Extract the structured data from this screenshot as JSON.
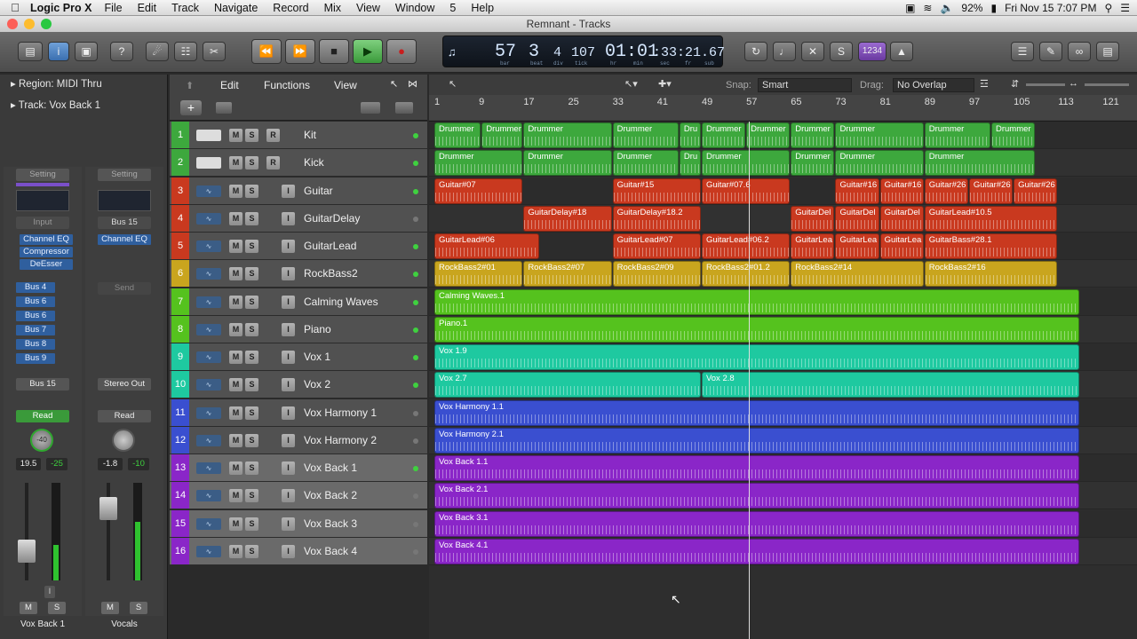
{
  "menubar": {
    "app_name": "Logic Pro X",
    "items": [
      "File",
      "Edit",
      "Track",
      "Navigate",
      "Record",
      "Mix",
      "View",
      "Window",
      "5",
      "Help"
    ],
    "battery": "92%",
    "datetime": "Fri Nov 15  7:07 PM"
  },
  "window": {
    "title": "Remnant - Tracks"
  },
  "lcd": {
    "bar": "57",
    "beat": "3",
    "div": "4",
    "tick": "107",
    "time_hm": "01:01",
    "time_rest": ":33:21.67",
    "labels": [
      "bar",
      "beat",
      "div",
      "tick",
      "hr",
      "min",
      "sec",
      "fr",
      "sub"
    ]
  },
  "lcd_btn": "1234",
  "inspector": {
    "region_label": "Region: MIDI Thru",
    "track_label": "Track:  Vox Back 1",
    "left_strip": {
      "setting": "Setting",
      "input": "Input",
      "plugins": [
        "Channel EQ",
        "Compressor",
        "DeEsser"
      ],
      "sends": [
        "Bus 4",
        "Bus 6",
        "Bus 6",
        "Bus 7",
        "Bus 8",
        "Bus 9"
      ],
      "output": "Bus 15",
      "mode": "Read",
      "knob": "-40",
      "vol": "19.5",
      "peak": "-25",
      "m": "M",
      "s": "S",
      "i": "I",
      "name": "Vox Back 1"
    },
    "right_strip": {
      "setting": "Setting",
      "input": "Bus 15",
      "plugins": [
        "Channel EQ"
      ],
      "send": "Send",
      "output": "Stereo Out",
      "mode": "Read",
      "vol": "-1.8",
      "peak": "-10",
      "m": "M",
      "s": "S",
      "name": "Vocals"
    }
  },
  "trackheader": {
    "edit": "Edit",
    "functions": "Functions",
    "view": "View",
    "add": "+"
  },
  "arrange_toolbar": {
    "snap_label": "Snap:",
    "snap_value": "Smart",
    "drag_label": "Drag:",
    "drag_value": "No Overlap"
  },
  "ruler": [
    "1",
    "9",
    "17",
    "25",
    "33",
    "41",
    "49",
    "57",
    "65",
    "73",
    "81",
    "89",
    "97",
    "105",
    "113",
    "121"
  ],
  "tracks": [
    {
      "num": "1",
      "name": "Kit",
      "color": "#3da83d",
      "kind": "drum",
      "r": true,
      "i": false,
      "led": "#3fd13f"
    },
    {
      "num": "2",
      "name": "Kick",
      "color": "#3da83d",
      "kind": "drum",
      "r": true,
      "i": false,
      "led": "#3fd13f"
    },
    {
      "num": "3",
      "name": "Guitar",
      "color": "#c9391f",
      "kind": "audio",
      "r": false,
      "i": true,
      "led": "#3fd13f"
    },
    {
      "num": "4",
      "name": "GuitarDelay",
      "color": "#c9391f",
      "kind": "audio",
      "r": false,
      "i": true,
      "led": "#777"
    },
    {
      "num": "5",
      "name": "GuitarLead",
      "color": "#c9391f",
      "kind": "audio",
      "r": false,
      "i": true,
      "led": "#3fd13f"
    },
    {
      "num": "6",
      "name": "RockBass2",
      "color": "#c9a51e",
      "kind": "audio",
      "r": false,
      "i": true,
      "led": "#3fd13f"
    },
    {
      "num": "7",
      "name": "Calming Waves",
      "color": "#55c21e",
      "kind": "audio",
      "r": false,
      "i": true,
      "led": "#3fd13f"
    },
    {
      "num": "8",
      "name": "Piano",
      "color": "#55c21e",
      "kind": "audio",
      "r": false,
      "i": true,
      "led": "#3fd13f"
    },
    {
      "num": "9",
      "name": "Vox 1",
      "color": "#1ec9a0",
      "kind": "audio",
      "r": false,
      "i": true,
      "led": "#3fd13f"
    },
    {
      "num": "10",
      "name": "Vox 2",
      "color": "#1ec9a0",
      "kind": "audio",
      "r": false,
      "i": true,
      "led": "#3fd13f"
    },
    {
      "num": "11",
      "name": "Vox Harmony 1",
      "color": "#3a4fd0",
      "kind": "audio",
      "r": false,
      "i": true,
      "led": "#777"
    },
    {
      "num": "12",
      "name": "Vox Harmony 2",
      "color": "#3a4fd0",
      "kind": "audio",
      "r": false,
      "i": true,
      "led": "#777"
    },
    {
      "num": "13",
      "name": "Vox Back 1",
      "color": "#8a26c8",
      "kind": "audio",
      "r": false,
      "i": true,
      "led": "#3fd13f",
      "sel": true
    },
    {
      "num": "14",
      "name": "Vox Back 2",
      "color": "#8a26c8",
      "kind": "audio",
      "r": false,
      "i": true,
      "led": "#777",
      "sel": true
    },
    {
      "num": "15",
      "name": "Vox Back 3",
      "color": "#8a26c8",
      "kind": "audio",
      "r": false,
      "i": true,
      "led": "#777",
      "sel": true
    },
    {
      "num": "16",
      "name": "Vox Back 4",
      "color": "#8a26c8",
      "kind": "audio",
      "r": false,
      "i": true,
      "led": "#777",
      "sel": true
    }
  ],
  "regions": [
    {
      "row": 0,
      "label": "Drummer",
      "start": 1,
      "end": 9.5
    },
    {
      "row": 0,
      "label": "Drummer",
      "start": 9.5,
      "end": 17
    },
    {
      "row": 0,
      "label": "Drummer",
      "start": 17,
      "end": 33
    },
    {
      "row": 0,
      "label": "Drummer",
      "start": 33,
      "end": 45
    },
    {
      "row": 0,
      "label": "Dru",
      "start": 45,
      "end": 49
    },
    {
      "row": 0,
      "label": "Drummer",
      "start": 49,
      "end": 57
    },
    {
      "row": 0,
      "label": "Drummer",
      "start": 57,
      "end": 65
    },
    {
      "row": 0,
      "label": "Drummer",
      "start": 65,
      "end": 73
    },
    {
      "row": 0,
      "label": "Drummer",
      "start": 73,
      "end": 89
    },
    {
      "row": 0,
      "label": "Drummer",
      "start": 89,
      "end": 101
    },
    {
      "row": 0,
      "label": "Drummer",
      "start": 101,
      "end": 109
    },
    {
      "row": 1,
      "label": "Drummer",
      "start": 1,
      "end": 17
    },
    {
      "row": 1,
      "label": "Drummer",
      "start": 17,
      "end": 33
    },
    {
      "row": 1,
      "label": "Drummer",
      "start": 33,
      "end": 45
    },
    {
      "row": 1,
      "label": "Dru",
      "start": 45,
      "end": 49
    },
    {
      "row": 1,
      "label": "Drummer",
      "start": 49,
      "end": 65
    },
    {
      "row": 1,
      "label": "Drummer",
      "start": 65,
      "end": 73
    },
    {
      "row": 1,
      "label": "Drummer",
      "start": 73,
      "end": 89
    },
    {
      "row": 1,
      "label": "Drummer",
      "start": 89,
      "end": 109
    },
    {
      "row": 2,
      "label": "Guitar#07",
      "start": 1,
      "end": 17
    },
    {
      "row": 2,
      "label": "Guitar#15",
      "start": 33,
      "end": 49
    },
    {
      "row": 2,
      "label": "Guitar#07.6",
      "start": 49,
      "end": 65
    },
    {
      "row": 2,
      "label": "Guitar#16",
      "start": 73,
      "end": 81
    },
    {
      "row": 2,
      "label": "Guitar#16",
      "start": 81,
      "end": 89
    },
    {
      "row": 2,
      "label": "Guitar#26",
      "start": 89,
      "end": 97
    },
    {
      "row": 2,
      "label": "Guitar#26",
      "start": 97,
      "end": 105
    },
    {
      "row": 2,
      "label": "Guitar#26",
      "start": 105,
      "end": 113
    },
    {
      "row": 3,
      "label": "GuitarDelay#18",
      "start": 17,
      "end": 33
    },
    {
      "row": 3,
      "label": "GuitarDelay#18.2",
      "start": 33,
      "end": 49
    },
    {
      "row": 3,
      "label": "GuitarDel",
      "start": 65,
      "end": 73
    },
    {
      "row": 3,
      "label": "GuitarDel",
      "start": 73,
      "end": 81
    },
    {
      "row": 3,
      "label": "GuitarDel",
      "start": 81,
      "end": 89
    },
    {
      "row": 3,
      "label": "GuitarLead#10.5",
      "start": 89,
      "end": 113
    },
    {
      "row": 4,
      "label": "GuitarLead#06",
      "start": 1,
      "end": 20
    },
    {
      "row": 4,
      "label": "GuitarLead#07",
      "start": 33,
      "end": 49
    },
    {
      "row": 4,
      "label": "GuitarLead#06.2",
      "start": 49,
      "end": 65
    },
    {
      "row": 4,
      "label": "GuitarLea",
      "start": 65,
      "end": 73
    },
    {
      "row": 4,
      "label": "GuitarLea",
      "start": 73,
      "end": 81
    },
    {
      "row": 4,
      "label": "GuitarLea",
      "start": 81,
      "end": 89
    },
    {
      "row": 4,
      "label": "GuitarBass#28.1",
      "start": 89,
      "end": 113
    },
    {
      "row": 5,
      "label": "RockBass2#01",
      "start": 1,
      "end": 17
    },
    {
      "row": 5,
      "label": "RockBass2#07",
      "start": 17,
      "end": 33
    },
    {
      "row": 5,
      "label": "RockBass2#09",
      "start": 33,
      "end": 49
    },
    {
      "row": 5,
      "label": "RockBass2#01.2",
      "start": 49,
      "end": 65
    },
    {
      "row": 5,
      "label": "RockBass2#14",
      "start": 65,
      "end": 89
    },
    {
      "row": 5,
      "label": "RockBass2#16",
      "start": 89,
      "end": 113
    },
    {
      "row": 6,
      "label": "Calming Waves.1",
      "start": 1,
      "end": 117
    },
    {
      "row": 7,
      "label": "Piano.1",
      "start": 1,
      "end": 117
    },
    {
      "row": 8,
      "label": "Vox 1.9",
      "start": 1,
      "end": 117
    },
    {
      "row": 9,
      "label": "Vox 2.7",
      "start": 1,
      "end": 49
    },
    {
      "row": 9,
      "label": "Vox 2.8",
      "start": 49,
      "end": 117
    },
    {
      "row": 10,
      "label": "Vox Harmony 1.1",
      "start": 1,
      "end": 117
    },
    {
      "row": 11,
      "label": "Vox Harmony 2.1",
      "start": 1,
      "end": 117
    },
    {
      "row": 12,
      "label": "Vox Back 1.1",
      "start": 1,
      "end": 117
    },
    {
      "row": 13,
      "label": "Vox Back 2.1",
      "start": 1,
      "end": 117
    },
    {
      "row": 14,
      "label": "Vox Back 3.1",
      "start": 1,
      "end": 117
    },
    {
      "row": 15,
      "label": "Vox Back 4.1",
      "start": 1,
      "end": 117
    }
  ],
  "playhead_bar": 57.4,
  "icons": {
    "m": "M",
    "s": "S",
    "r": "R",
    "i": "I"
  }
}
